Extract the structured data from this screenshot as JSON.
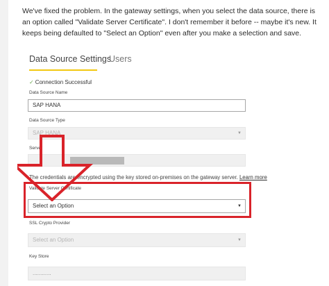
{
  "post": {
    "text": "We've fixed the problem. In the gateway settings, when you select the data source, there is an option called \"Validate Server Certificate\". I don't remember it before -- maybe it's new. It keeps being defaulted to \"Select an Option\" even after you make a selection and save."
  },
  "tabs": [
    {
      "label": "Data Source Settings",
      "active": true
    },
    {
      "label": "Users",
      "active": false
    }
  ],
  "status": {
    "icon": "check-icon",
    "text": "Connection Successful"
  },
  "fields": {
    "data_source_name": {
      "label": "Data Source Name",
      "value": "SAP HANA"
    },
    "data_source_type": {
      "label": "Data Source Type",
      "value": "SAP HANA"
    },
    "server": {
      "label": "Server"
    },
    "validate_server_certificate": {
      "label": "Validate Server Certificate",
      "value": "Select an Option"
    },
    "ssl_crypto_provider": {
      "label": "SSL Crypto Provider",
      "value": "Select an Option"
    },
    "key_store": {
      "label": "Key Store",
      "value": "............"
    }
  },
  "note": {
    "prefix": "The credentials are encrypted using the key stored on-premises on the gateway server.",
    "link": "Learn more"
  },
  "annotation": {
    "color": "#d9232a"
  },
  "colors": {
    "tab_accent": "#f2c811",
    "success": "#6aa84f"
  }
}
